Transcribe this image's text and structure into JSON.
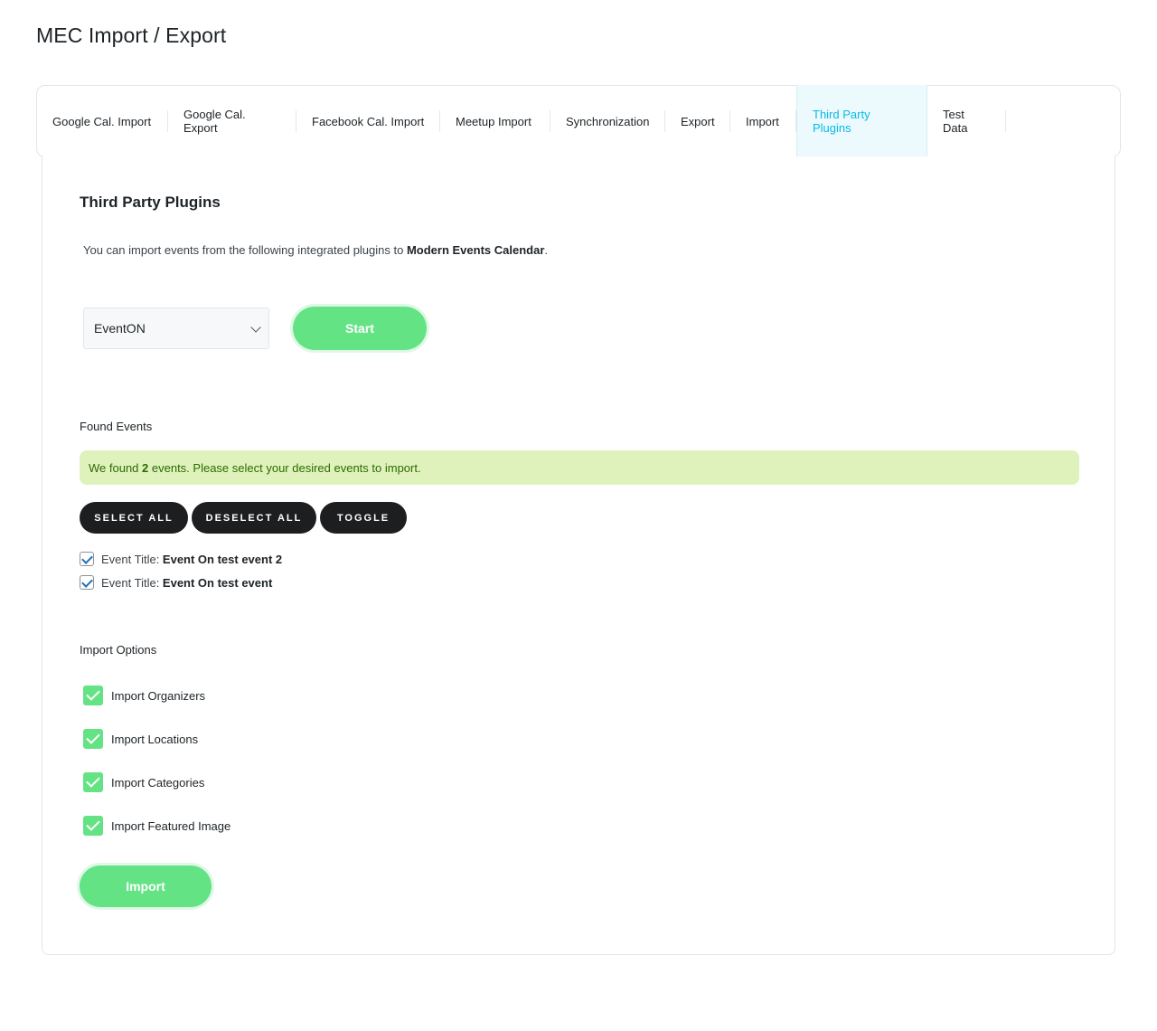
{
  "page": {
    "title": "MEC Import / Export"
  },
  "tabs": [
    {
      "label": "Google Cal. Import",
      "active": false
    },
    {
      "label": "Google Cal. Export",
      "active": false
    },
    {
      "label": "Facebook Cal. Import",
      "active": false
    },
    {
      "label": "Meetup Import",
      "active": false
    },
    {
      "label": "Synchronization",
      "active": false
    },
    {
      "label": "Export",
      "active": false
    },
    {
      "label": "Import",
      "active": false
    },
    {
      "label": "Third Party Plugins",
      "active": true
    },
    {
      "label": "Test Data",
      "active": false
    }
  ],
  "section": {
    "title": "Third Party Plugins",
    "description_prefix": "You can import events from the following integrated plugins to ",
    "description_strong": "Modern Events Calendar",
    "description_suffix": "."
  },
  "plugin_select": {
    "value": "EventON",
    "icon": "chevron-down-icon"
  },
  "start_button": {
    "label": "Start"
  },
  "found_events": {
    "heading": "Found Events",
    "notice_prefix": "We found ",
    "notice_count": "2",
    "notice_suffix": " events. Please select your desired events to import."
  },
  "bulk_buttons": {
    "select_all": "SELECT ALL",
    "deselect_all": "DESELECT ALL",
    "toggle": "TOGGLE"
  },
  "events": [
    {
      "prefix": "Event Title: ",
      "name": "Event On test event 2",
      "checked": true
    },
    {
      "prefix": "Event Title: ",
      "name": "Event On test event",
      "checked": true
    }
  ],
  "import_options": {
    "heading": "Import Options",
    "options": [
      {
        "label": "Import Organizers",
        "checked": true
      },
      {
        "label": "Import Locations",
        "checked": true
      },
      {
        "label": "Import Categories",
        "checked": true
      },
      {
        "label": "Import Featured Image",
        "checked": true
      }
    ]
  },
  "import_button": {
    "label": "Import"
  },
  "colors": {
    "accent_tab": "#07bbe9",
    "green": "#64e385",
    "notice_bg": "#dff2bc",
    "pill_bg": "#1d1e20"
  }
}
